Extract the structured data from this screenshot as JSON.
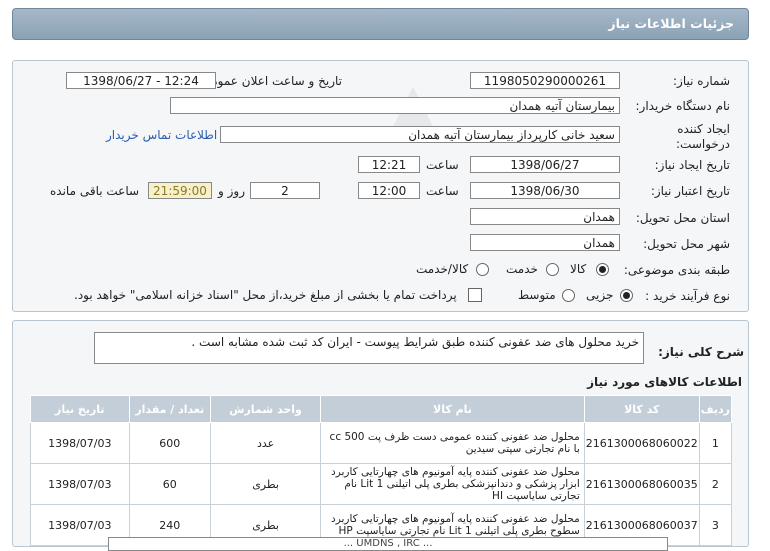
{
  "header": {
    "title": "جزئیات اطلاعات نیاز"
  },
  "form": {
    "need_number_label": "شماره نیاز:",
    "need_number": "1198050290000261",
    "announce_label": "تاریخ و ساعت اعلان عمومی:",
    "announce_value": "1398/06/27 - 12:24",
    "buyer_org_label": "نام دستگاه خریدار:",
    "buyer_org": "بیمارستان آتیه همدان",
    "creator_label": "ایجاد کننده درخواست:",
    "creator": "سعید خانی کارپرداز بیمارستان آتیه همدان",
    "contact_link": "اطلاعات تماس خریدار",
    "created_date_label": "تاریخ ایجاد نیاز:",
    "created_date": "1398/06/27",
    "time_label": "ساعت",
    "created_time": "12:21",
    "validity_label": "تاریخ اعتبار نیاز:",
    "validity_date": "1398/06/30",
    "validity_time": "12:00",
    "days": "2",
    "days_label": "روز و",
    "remaining": "21:59:00",
    "remaining_label": "ساعت باقی مانده",
    "province_label": "استان محل تحویل:",
    "province": "همدان",
    "city_label": "شهر محل تحویل:",
    "city": "همدان",
    "category_label": "طبقه بندی موضوعی:",
    "category_options": [
      "کالا",
      "خدمت",
      "کالا/خدمت"
    ],
    "category_selected": "کالا",
    "process_label": "نوع فرآیند خرید :",
    "process_options": [
      "جزیی",
      "متوسط"
    ],
    "process_selected": "جزیی",
    "payment_note": "پرداخت تمام یا بخشی از مبلغ خرید،از محل \"اسناد خزانه اسلامی\" خواهد بود."
  },
  "description": {
    "label": "شرح کلی نیاز:",
    "text": "خرید محلول های ضد عفونی کننده طبق شرایط پیوست - ایران کد ثبت شده مشابه است ."
  },
  "items": {
    "title": "اطلاعات کالاهای مورد نیاز",
    "columns": [
      "ردیف",
      "کد کالا",
      "نام کالا",
      "واحد شمارش",
      "تعداد / مقدار",
      "تاریخ نیاز"
    ],
    "rows": [
      {
        "row": "1",
        "code": "2161300068060022",
        "name": "محلول ضد عفونی کننده عمومی دست ظرف پت 500 cc با نام تجارتی سپتی سیدین",
        "unit": "عدد",
        "qty": "600",
        "date": "1398/07/03"
      },
      {
        "row": "2",
        "code": "2161300068060035",
        "name": "محلول ضد عفونی کننده پایه آمونیوم های چهارتایی کاربرد ابزار پزشکی و دندانپزشکی بطری پلی اتیلنی 1 Lit نام تجارتی سایاسپت HI",
        "unit": "بطری",
        "qty": "60",
        "date": "1398/07/03"
      },
      {
        "row": "3",
        "code": "2161300068060037",
        "name": "محلول ضد عفونی کننده پایه آمونیوم های چهارتایی کاربرد سطوح بطری پلی اتیلنی 1 Lit نام تجارتی سایاسپت HP",
        "unit": "بطری",
        "qty": "240",
        "date": "1398/07/03"
      }
    ]
  },
  "footer_partial": "... UMDNS , IRC ..."
}
